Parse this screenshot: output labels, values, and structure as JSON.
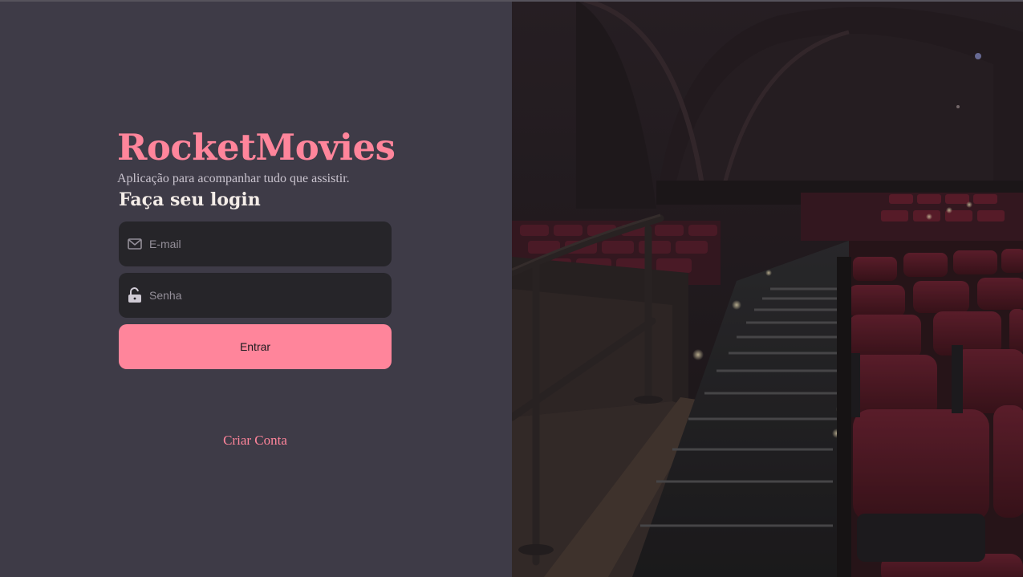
{
  "brand": {
    "title": "RocketMovies",
    "tagline": "Aplicação para acompanhar tudo que assistir."
  },
  "login": {
    "heading": "Faça seu login",
    "email": {
      "placeholder": "E-mail",
      "value": "",
      "icon": "mail-icon"
    },
    "password": {
      "placeholder": "Senha",
      "value": "",
      "icon": "unlock-icon"
    },
    "submit_label": "Entrar",
    "create_account_label": "Criar Conta"
  },
  "hero": {
    "image": "cinema-theater-seats-photo"
  },
  "colors": {
    "background": "#3e3b47",
    "input_background": "#262529",
    "accent": "#ff859b",
    "heading_text": "#f4ede8",
    "muted_text": "#948f99"
  }
}
